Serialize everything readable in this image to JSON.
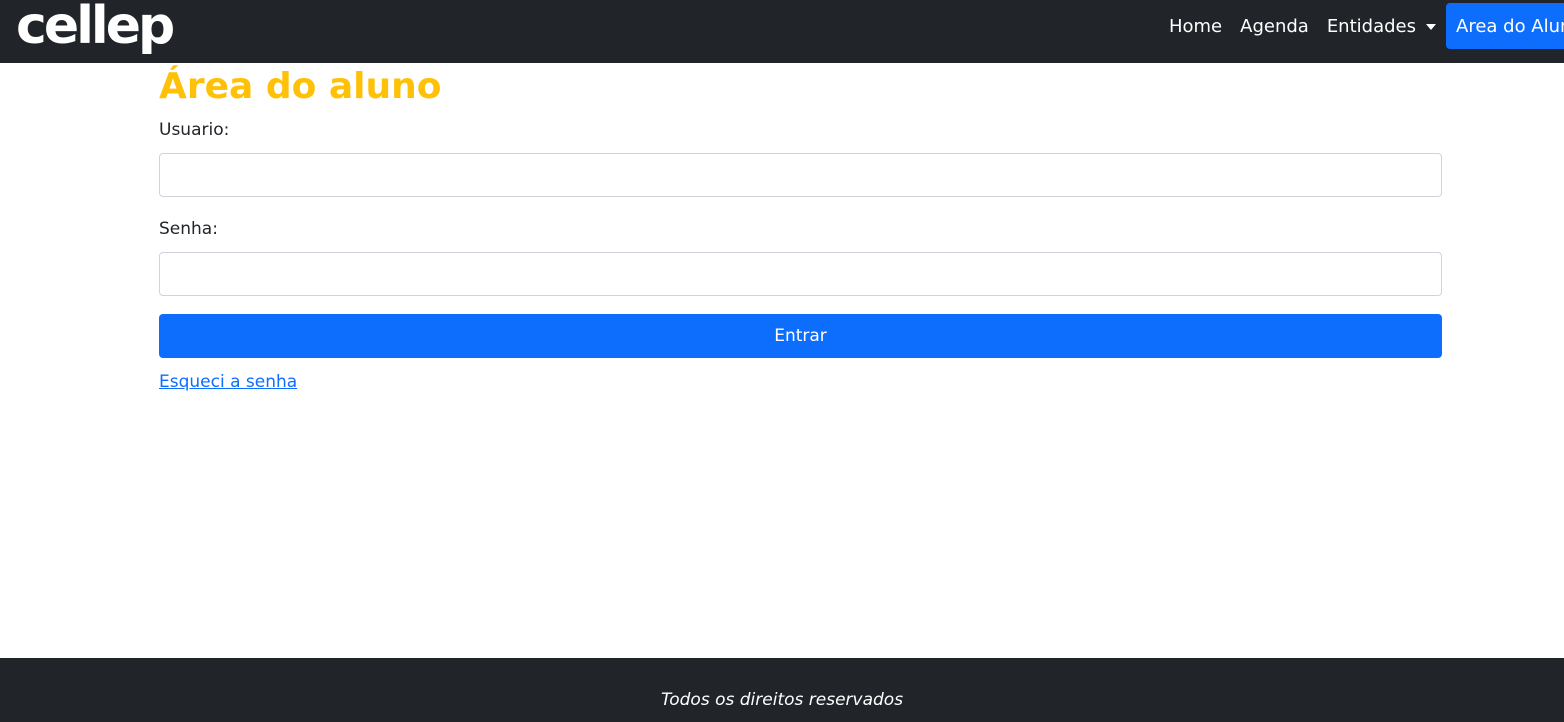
{
  "navbar": {
    "logo_text": "cellep",
    "links": {
      "home": "Home",
      "agenda": "Agenda",
      "entidades": "Entidades",
      "area_aluno": "Area do Aluno"
    }
  },
  "main": {
    "title": "Área do aluno",
    "usuario_label": "Usuario:",
    "usuario_value": "",
    "senha_label": "Senha:",
    "senha_value": "",
    "submit_label": "Entrar",
    "forgot_label": "Esqueci a senha"
  },
  "footer": {
    "text": "Todos os direitos reservados"
  },
  "colors": {
    "navbar_bg": "#212529",
    "primary": "#0d6efd",
    "title": "#ffc107"
  }
}
